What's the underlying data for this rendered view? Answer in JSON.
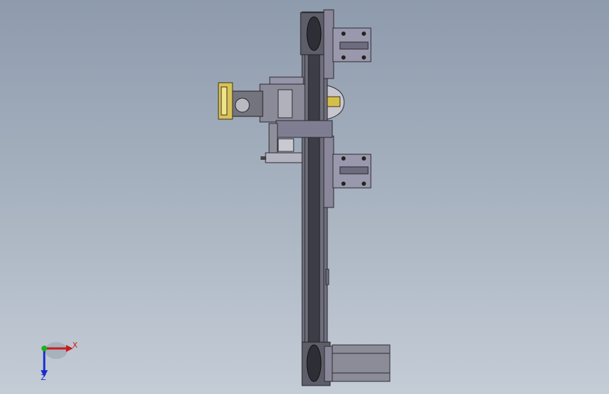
{
  "viewport": {
    "background_top": "#8e9bad",
    "background_bottom": "#c4ccd6"
  },
  "model": {
    "description": "",
    "part_color": "#7d7d8c",
    "rail_color": "#3b3b45",
    "plate_color": "#8c8a9c",
    "highlight_color": "#e5d46a",
    "motor_color": "#8a8a95"
  },
  "triad": {
    "x_label": "X",
    "z_label": "Z",
    "x_color": "#cc1b1b",
    "y_color": "#1ab31a",
    "z_color": "#1a2bcc"
  }
}
